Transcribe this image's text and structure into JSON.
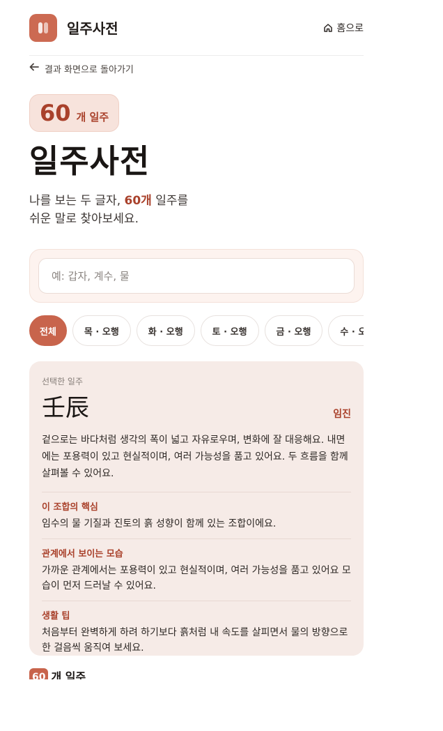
{
  "header": {
    "brand_name": "일주사전",
    "home_label": "홈으로"
  },
  "back_link": {
    "label": "결과 화면으로 돌아가기"
  },
  "count_badge": {
    "number": "60",
    "unit": "개 일주"
  },
  "page_title": "일주사전",
  "subtitle": {
    "line1_prefix": "나를 보는 두 글자, ",
    "line1_highlight": "60개",
    "line1_suffix": " 일주를",
    "line2": "쉬운 말로 찾아보세요."
  },
  "search": {
    "placeholder": "예: 갑자, 계수, 물",
    "value": ""
  },
  "filters": [
    {
      "label": "전체",
      "active": true
    },
    {
      "label": "목 · 오행",
      "active": false
    },
    {
      "label": "화 · 오행",
      "active": false
    },
    {
      "label": "토 · 오행",
      "active": false
    },
    {
      "label": "금 · 오행",
      "active": false
    },
    {
      "label": "수 · 오행",
      "active": false
    }
  ],
  "selected": {
    "kicker": "선택한 일주",
    "hanja": "壬辰",
    "reading": "임진",
    "description": "겉으로는 바다처럼 생각의 폭이 넓고 자유로우며, 변화에 잘 대응해요. 내면에는 포용력이 있고 현실적이며, 여러 가능성을 품고 있어요. 두 흐름을 함께 살펴볼 수 있어요.",
    "sections": [
      {
        "title": "이 조합의 핵심",
        "body": "임수의 물 기질과 진토의 흙 성향이 함께 있는 조합이에요."
      },
      {
        "title": "관계에서 보이는 모습",
        "body": "가까운 관계에서는 포용력이 있고 현실적이며, 여러 가능성을 품고 있어요 모습이 먼저 드러날 수 있어요."
      },
      {
        "title": "생활 팁",
        "body": "처음부터 완벽하게 하려 하기보다 흙처럼 내 속도를 살피면서 물의 방향으로 한 걸음씩 움직여 보세요."
      }
    ]
  },
  "footer_peek": {
    "badge": "60",
    "text": "개 일주"
  },
  "colors": {
    "accent": "#c8644c",
    "accent_text": "#a9412b",
    "card_bg": "#f6ebe7"
  }
}
